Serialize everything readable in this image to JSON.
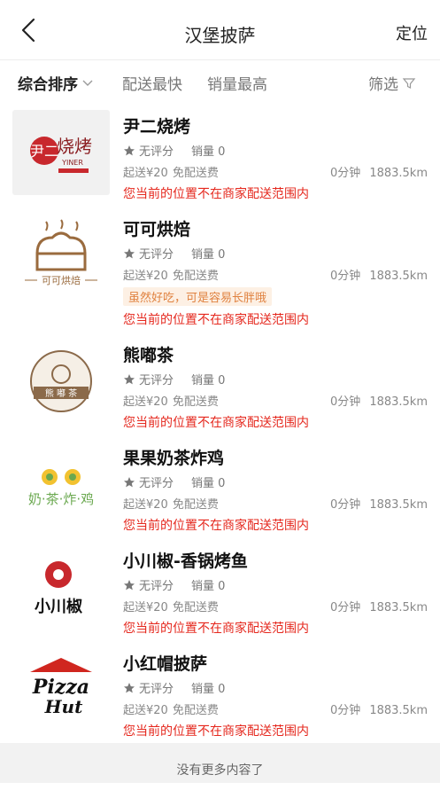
{
  "header": {
    "title": "汉堡披萨",
    "locate_label": "定位"
  },
  "filters": [
    {
      "label": "综合排序",
      "active": true
    },
    {
      "label": "配送最快",
      "active": false
    },
    {
      "label": "销量最高",
      "active": false
    },
    {
      "label": "筛选",
      "active": false
    }
  ],
  "shops": [
    {
      "name": "尹二烧烤",
      "rating": "无评分",
      "sales": "销量 0",
      "min_order": "起送¥20",
      "delivery_fee": "免配送费",
      "time": "0分钟",
      "distance": "1883.5km",
      "promo": "",
      "warning": "您当前的位置不在商家配送范围内",
      "logo_text": "YINER",
      "logo_main": "尹二",
      "logo_sub": "烧烤"
    },
    {
      "name": "可可烘焙",
      "rating": "无评分",
      "sales": "销量 0",
      "min_order": "起送¥20",
      "delivery_fee": "免配送费",
      "time": "0分钟",
      "distance": "1883.5km",
      "promo": "虽然好吃，可是容易长胖哦",
      "warning": "您当前的位置不在商家配送范围内",
      "logo_text": "可可烘焙"
    },
    {
      "name": "熊嘟茶",
      "rating": "无评分",
      "sales": "销量 0",
      "min_order": "起送¥20",
      "delivery_fee": "免配送费",
      "time": "0分钟",
      "distance": "1883.5km",
      "promo": "",
      "warning": "您当前的位置不在商家配送范围内",
      "logo_text": "熊 嘟 茶"
    },
    {
      "name": "果果奶茶炸鸡",
      "rating": "无评分",
      "sales": "销量 0",
      "min_order": "起送¥20",
      "delivery_fee": "免配送费",
      "time": "0分钟",
      "distance": "1883.5km",
      "promo": "",
      "warning": "您当前的位置不在商家配送范围内",
      "logo_text": "奶·茶·炸·鸡"
    },
    {
      "name": "小川椒-香锅烤鱼",
      "rating": "无评分",
      "sales": "销量 0",
      "min_order": "起送¥20",
      "delivery_fee": "免配送费",
      "time": "0分钟",
      "distance": "1883.5km",
      "promo": "",
      "warning": "您当前的位置不在商家配送范围内",
      "logo_text": "小川椒"
    },
    {
      "name": "小红帽披萨",
      "rating": "无评分",
      "sales": "销量 0",
      "min_order": "起送¥20",
      "delivery_fee": "免配送费",
      "time": "0分钟",
      "distance": "1883.5km",
      "promo": "",
      "warning": "您当前的位置不在商家配送范围内",
      "logo_text": "Pizza",
      "logo_text2": "Hut"
    }
  ],
  "footer": {
    "text": "没有更多内容了"
  },
  "colors": {
    "warning": "#e5281e",
    "promo": "#e08240",
    "promo_bg": "#fdf0e4"
  }
}
